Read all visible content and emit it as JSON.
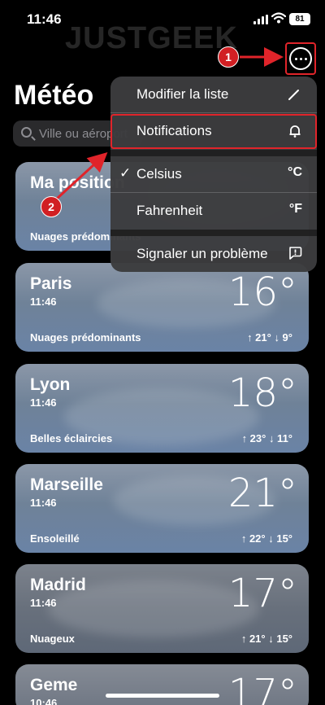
{
  "status": {
    "time": "11:46",
    "battery": "81"
  },
  "watermark": "JUSTGEEK",
  "header": {
    "title": "Météo",
    "search_placeholder": "Ville ou aéroport"
  },
  "menu": {
    "items": [
      {
        "label": "Modifier la liste",
        "icon": "pencil-icon"
      },
      {
        "label": "Notifications",
        "icon": "bell-icon"
      },
      {
        "label": "Celsius",
        "unit": "°C",
        "checked": true
      },
      {
        "label": "Fahrenheit",
        "unit": "°F",
        "checked": false
      },
      {
        "label": "Signaler un problème",
        "icon": "report-icon"
      }
    ]
  },
  "callouts": {
    "one": "1",
    "two": "2"
  },
  "cards": [
    {
      "city": "Ma position",
      "time": "",
      "temp": "",
      "condition": "Nuages prédominants",
      "hilo": ""
    },
    {
      "city": "Paris",
      "time": "11:46",
      "temp": "16°",
      "condition": "Nuages prédominants",
      "hilo": "↑ 21° ↓ 9°"
    },
    {
      "city": "Lyon",
      "time": "11:46",
      "temp": "18°",
      "condition": "Belles éclaircies",
      "hilo": "↑ 23° ↓ 11°"
    },
    {
      "city": "Marseille",
      "time": "11:46",
      "temp": "21°",
      "condition": "Ensoleillé",
      "hilo": "↑ 22° ↓ 15°"
    },
    {
      "city": "Madrid",
      "time": "11:46",
      "temp": "17°",
      "condition": "Nuageux",
      "hilo": "↑ 21° ↓ 15°"
    },
    {
      "city": "Geme",
      "time": "10:46",
      "temp": "17°",
      "condition": "",
      "hilo": ""
    }
  ],
  "colors": {
    "highlight": "#e0242a",
    "badge": "#d11f23"
  }
}
